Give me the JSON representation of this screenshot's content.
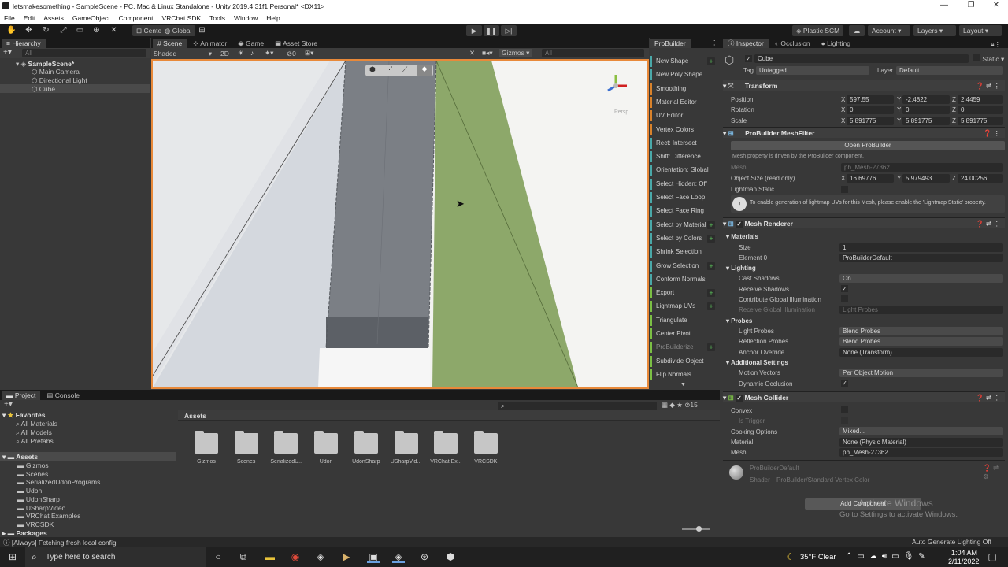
{
  "window": {
    "title": "letsmakesomething - SampleScene - PC, Mac & Linux Standalone - Unity 2019.4.31f1 Personal* <DX11>",
    "minimize": "—",
    "maximize": "❐",
    "close": "✕"
  },
  "menu": [
    "File",
    "Edit",
    "Assets",
    "GameObject",
    "Component",
    "VRChat SDK",
    "Tools",
    "Window",
    "Help"
  ],
  "toolbar": {
    "pivot": "Center",
    "space": "Global",
    "plastic": "Plastic SCM",
    "account": "Account",
    "layers": "Layers",
    "layout": "Layout"
  },
  "hierarchy": {
    "tab": "Hierarchy",
    "search": "All",
    "scene": "SampleScene*",
    "items": [
      "Main Camera",
      "Directional Light",
      "Cube"
    ]
  },
  "scene_tabs": [
    "Scene",
    "Animator",
    "Game",
    "Asset Store"
  ],
  "scene_toolbar": {
    "shading": "Shaded",
    "mode2d": "2D",
    "fx_count": "0",
    "gizmos": "Gizmos",
    "search": "All"
  },
  "scene_view": {
    "persp": "Persp"
  },
  "probuilder": {
    "tab": "ProBuilder",
    "buttons": [
      {
        "label": "New Shape",
        "plus": true,
        "color": "#4aa8a8"
      },
      {
        "label": "New Poly Shape",
        "plus": false,
        "color": "#4aa8a8"
      },
      {
        "label": "Smoothing",
        "plus": false,
        "color": "#d9822b"
      },
      {
        "label": "Material Editor",
        "plus": false,
        "color": "#d9822b"
      },
      {
        "label": "UV Editor",
        "plus": false,
        "color": "#d9822b"
      },
      {
        "label": "Vertex Colors",
        "plus": false,
        "color": "#d9822b"
      },
      {
        "label": "Rect: Intersect",
        "plus": false,
        "color": "#4aa8a8"
      },
      {
        "label": "Shift: Difference",
        "plus": false,
        "color": "#4aa8a8"
      },
      {
        "label": "Orientation: Global",
        "plus": false,
        "color": "#4aa8a8"
      },
      {
        "label": "Select Hidden: Off",
        "plus": false,
        "color": "#4aa8a8"
      },
      {
        "label": "Select Face Loop",
        "plus": false,
        "color": "#4aa8a8"
      },
      {
        "label": "Select Face Ring",
        "plus": false,
        "color": "#4aa8a8"
      },
      {
        "label": "Select by Material",
        "plus": true,
        "color": "#4aa8a8"
      },
      {
        "label": "Select by Colors",
        "plus": true,
        "color": "#4aa8a8"
      },
      {
        "label": "Shrink Selection",
        "plus": false,
        "color": "#4aa8a8"
      },
      {
        "label": "Grow Selection",
        "plus": true,
        "color": "#4aa8a8"
      },
      {
        "label": "Conform Normals",
        "plus": false,
        "color": "#4aa8a8"
      },
      {
        "label": "Export",
        "plus": true,
        "color": "#7bbf44"
      },
      {
        "label": "Lightmap UVs",
        "plus": true,
        "color": "#7bbf44"
      },
      {
        "label": "Triangulate",
        "plus": false,
        "color": "#7bbf44"
      },
      {
        "label": "Center Pivot",
        "plus": false,
        "color": "#7bbf44"
      },
      {
        "label": "ProBuilderize",
        "plus": true,
        "color": "#7bbf44"
      },
      {
        "label": "Subdivide Object",
        "plus": false,
        "color": "#7bbf44"
      },
      {
        "label": "Flip Normals",
        "plus": false,
        "color": "#7bbf44"
      }
    ]
  },
  "inspector": {
    "tabs": [
      "Inspector",
      "Occlusion",
      "Lighting"
    ],
    "object": {
      "name": "Cube",
      "static": "Static",
      "tag_label": "Tag",
      "tag": "Untagged",
      "layer_label": "Layer",
      "layer": "Default"
    },
    "transform": {
      "title": "Transform",
      "rows": [
        {
          "label": "Position",
          "x": "597.55",
          "y": "-2.4822",
          "z": "2.4459"
        },
        {
          "label": "Rotation",
          "x": "0",
          "y": "0",
          "z": "0"
        },
        {
          "label": "Scale",
          "x": "5.891775",
          "y": "5.891775",
          "z": "5.891775"
        }
      ]
    },
    "meshfilter": {
      "title": "ProBuilder MeshFilter",
      "open": "Open ProBuilder",
      "note": "Mesh property is driven by the ProBuilder component.",
      "mesh_label": "Mesh",
      "mesh": "pb_Mesh-27362",
      "size_label": "Object Size (read only)",
      "size_x": "16.69776",
      "size_y": "5.979493",
      "size_z": "24.00256",
      "lightmap_static": "Lightmap Static",
      "info": "To enable generation of lightmap UVs for this Mesh, please enable the 'Lightmap Static' property."
    },
    "renderer": {
      "title": "Mesh Renderer",
      "materials": "Materials",
      "size_label": "Size",
      "size": "1",
      "element_label": "Element 0",
      "element": "ProBuilderDefault",
      "lighting": "Lighting",
      "cast_label": "Cast Shadows",
      "cast": "On",
      "receive_label": "Receive Shadows",
      "contribute_label": "Contribute Global Illumination",
      "rgi_label": "Receive Global Illumination",
      "rgi": "Light Probes",
      "probes": "Probes",
      "lp_label": "Light Probes",
      "lp": "Blend Probes",
      "rp_label": "Reflection Probes",
      "rp": "Blend Probes",
      "anchor_label": "Anchor Override",
      "anchor": "None (Transform)",
      "additional": "Additional Settings",
      "mv_label": "Motion Vectors",
      "mv": "Per Object Motion",
      "do_label": "Dynamic Occlusion"
    },
    "collider": {
      "title": "Mesh Collider",
      "convex_label": "Convex",
      "trigger_label": "Is Trigger",
      "cooking_label": "Cooking Options",
      "cooking": "Mixed...",
      "material_label": "Material",
      "material": "None (Physic Material)",
      "mesh_label": "Mesh",
      "mesh": "pb_Mesh-27362"
    },
    "material": {
      "name": "ProBuilderDefault",
      "shader_label": "Shader",
      "shader": "ProBuilder/Standard Vertex Color"
    },
    "add_component": "Add Component",
    "watermark1": "Activate Windows",
    "watermark2": "Go to Settings to activate Windows."
  },
  "project": {
    "tabs": [
      "Project",
      "Console"
    ],
    "count": "15",
    "favorites": "Favorites",
    "fav_items": [
      "All Materials",
      "All Models",
      "All Prefabs"
    ],
    "assets": "Assets",
    "tree": [
      "Gizmos",
      "Scenes",
      "SerializedUdonPrograms",
      "Udon",
      "UdonSharp",
      "USharpVideo",
      "VRChat Examples",
      "VRCSDK"
    ],
    "packages": "Packages",
    "breadcrumb": "Assets",
    "folders": [
      "Gizmos",
      "Scenes",
      "SerializedU...",
      "Udon",
      "UdonSharp",
      "USharpVid...",
      "VRChat Ex...",
      "VRCSDK"
    ]
  },
  "status": {
    "message": "[Always] Fetching fresh local config",
    "right": "Auto Generate Lighting Off"
  },
  "taskbar": {
    "search": "Type here to search",
    "temp": "35°F",
    "weather": "Clear",
    "time": "1:04 AM",
    "date": "2/11/2022"
  },
  "colors": {
    "selection": "#2c5d87",
    "scene_border": "#e8893a",
    "green_face": "#8da86a"
  }
}
